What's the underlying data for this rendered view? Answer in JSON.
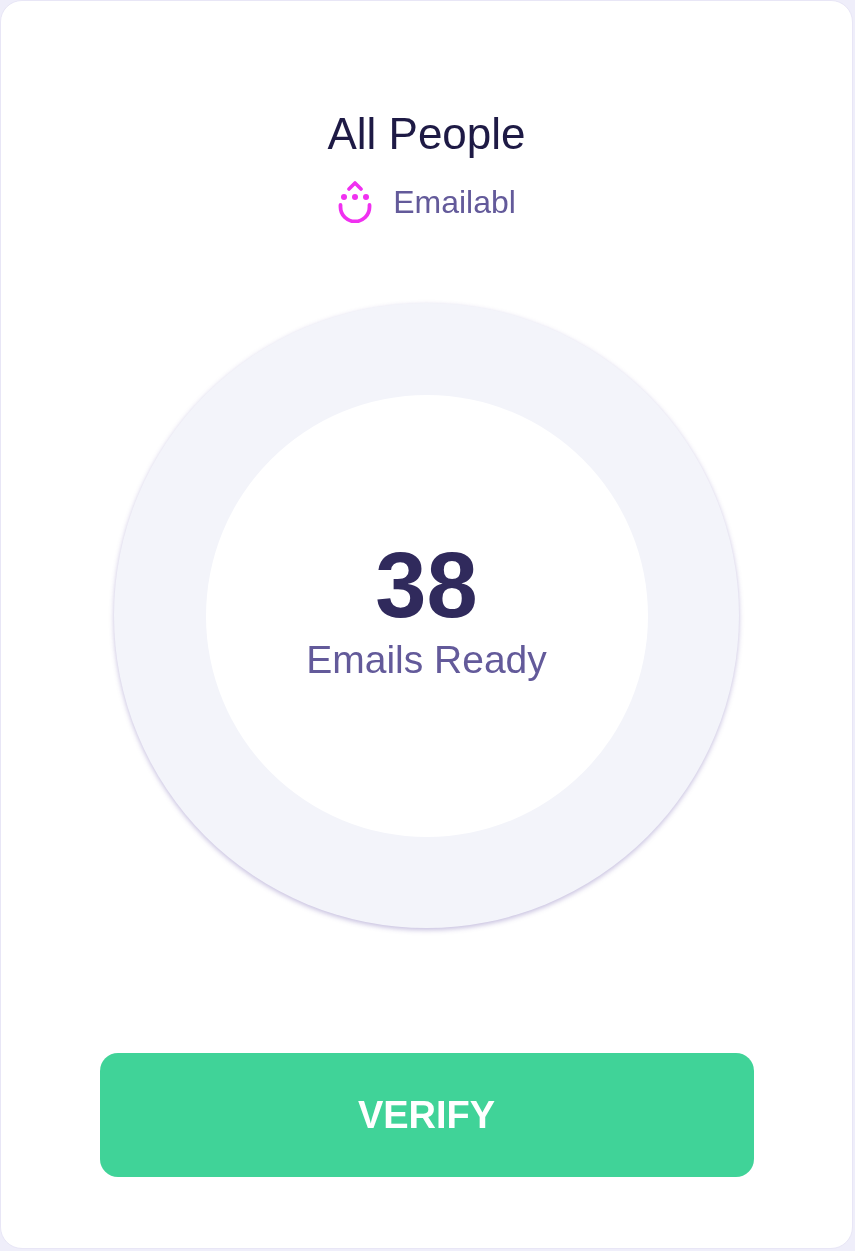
{
  "card": {
    "title": "All People",
    "source": {
      "label": "Emailabl"
    }
  },
  "summary": {
    "count": "38",
    "caption": "Emails Ready"
  },
  "button": {
    "label": "VERIFY"
  }
}
